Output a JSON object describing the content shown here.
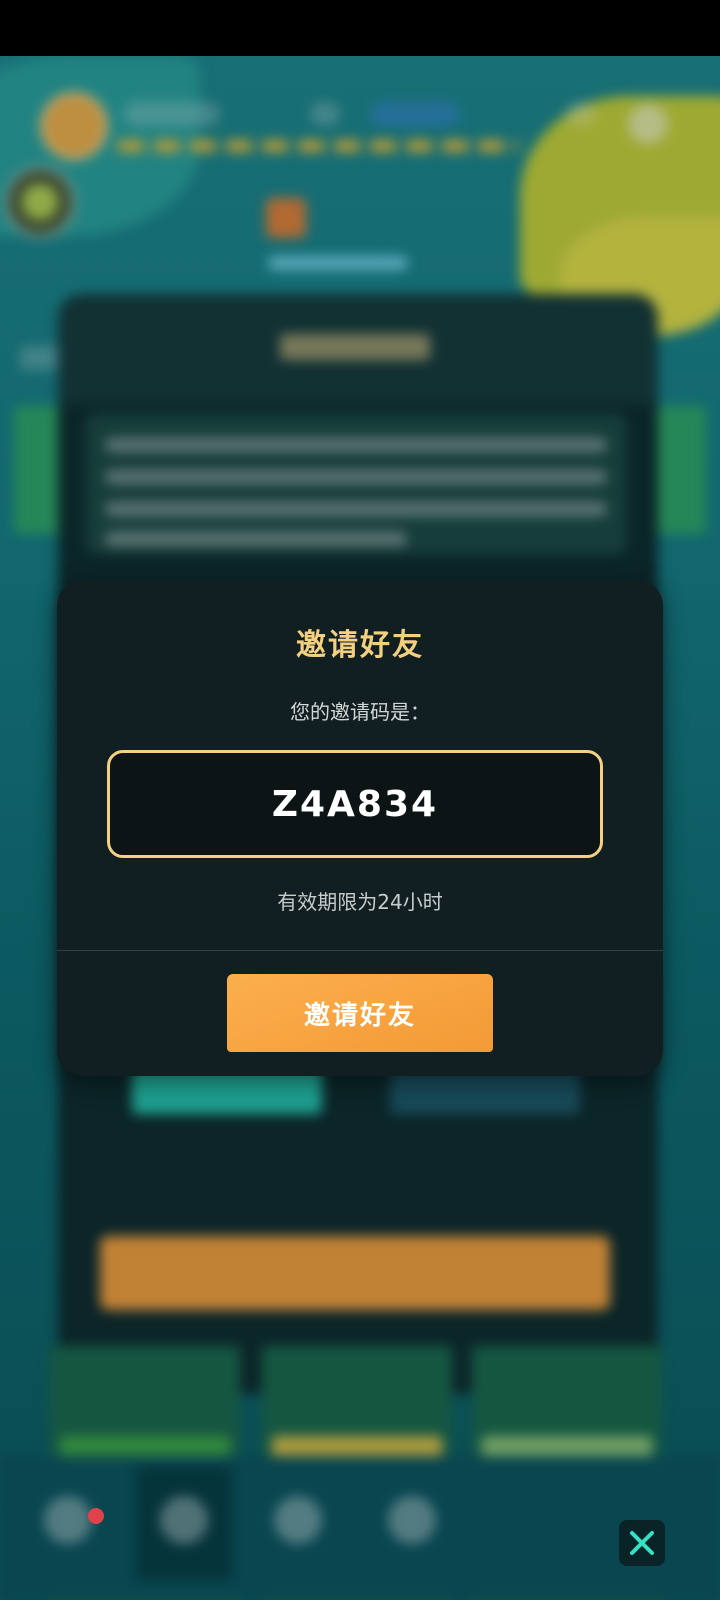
{
  "dialog": {
    "title": "邀请好友",
    "code_label": "您的邀请码是：",
    "invite_code": "Z4A834",
    "validity_note": "有效期限为24小时",
    "invite_button_label": "邀请好友"
  },
  "colors": {
    "title_gold": "#f3cf80",
    "code_border": "#f3d084",
    "button_orange": "#f7a23f",
    "dialog_bg": "#121f22"
  },
  "bottom_nav": {
    "icons": [
      "warning-triangle-icon",
      "shield-bag-icon",
      "compass-icon",
      "heart-icon"
    ],
    "close_icon": "close-x-icon"
  }
}
